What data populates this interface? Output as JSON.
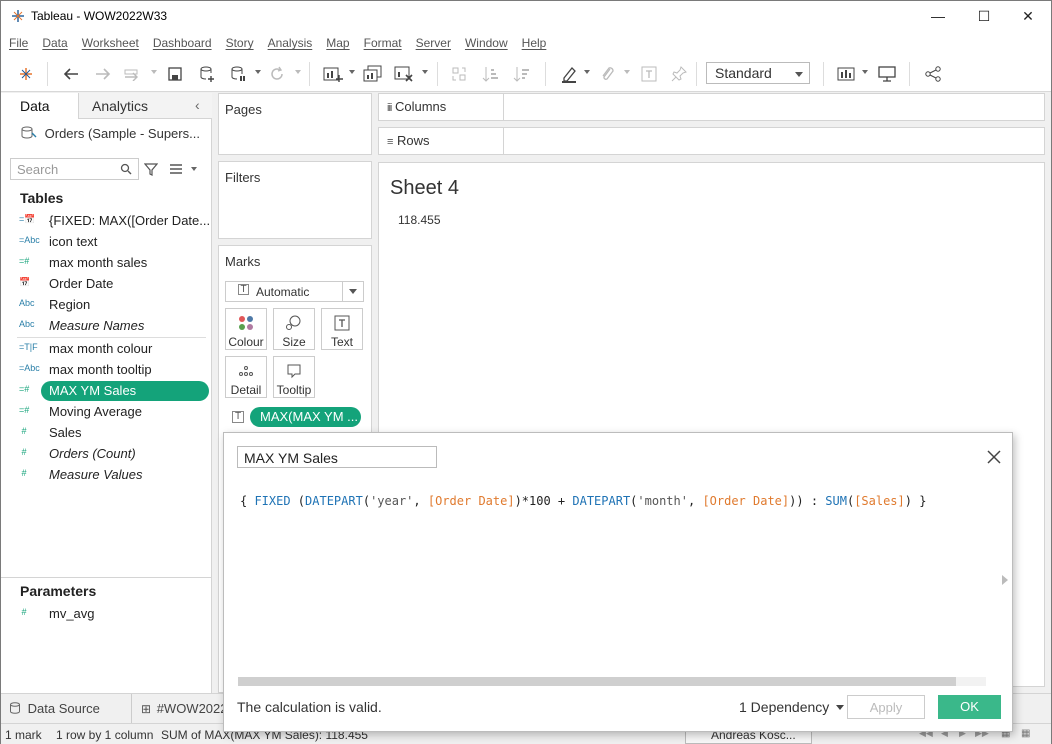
{
  "window": {
    "title": "Tableau - WOW2022W33"
  },
  "menu": [
    "File",
    "Data",
    "Worksheet",
    "Dashboard",
    "Story",
    "Analysis",
    "Map",
    "Format",
    "Server",
    "Window",
    "Help"
  ],
  "toolbar": {
    "fit_value": "Standard"
  },
  "left_pane": {
    "tab_data": "Data",
    "tab_analytics": "Analytics",
    "data_source": "Orders (Sample - Supers...",
    "search_placeholder": "Search",
    "tables_label": "Tables",
    "fields": [
      {
        "icon": "calendar-icon",
        "label": "{FIXED: MAX([Order Date..."
      },
      {
        "icon": "abc-icon",
        "label": "icon text"
      },
      {
        "icon": "hash-icon",
        "label": "max month sales"
      },
      {
        "icon": "calendar-icon",
        "label": "Order Date"
      },
      {
        "icon": "abc-icon",
        "label": "Region"
      },
      {
        "icon": "abc-icon",
        "label": "Measure Names"
      },
      {
        "icon": "tf-icon",
        "label": "max month colour"
      },
      {
        "icon": "abc-icon",
        "label": "max month tooltip"
      },
      {
        "icon": "hash-icon",
        "label": "MAX YM Sales"
      },
      {
        "icon": "hash-icon",
        "label": "Moving Average"
      },
      {
        "icon": "hash-icon",
        "label": "Sales"
      },
      {
        "icon": "hash-icon",
        "label": "Orders (Count)"
      },
      {
        "icon": "hash-icon",
        "label": "Measure Values"
      }
    ],
    "parameters_label": "Parameters",
    "parameters": [
      {
        "icon": "hash-icon",
        "label": "mv_avg"
      }
    ]
  },
  "cards": {
    "pages": "Pages",
    "filters": "Filters",
    "marks": "Marks",
    "mark_type": "Automatic",
    "mark_buttons": [
      "Colour",
      "Size",
      "Text",
      "Detail",
      "Tooltip"
    ],
    "mark_pill": "MAX(MAX YM ..."
  },
  "shelves": {
    "columns": "Columns",
    "rows": "Rows"
  },
  "view": {
    "sheet_title": "Sheet 4",
    "value": "118.455"
  },
  "calc_editor": {
    "name": "MAX YM Sales",
    "formula": {
      "p1": "{ ",
      "p2": "FIXED",
      "p3": " (",
      "p4": "DATEPART",
      "p5": "(",
      "p6": "'year'",
      "p7": ", ",
      "p8": "[Order Date]",
      "p9": ")*100 + ",
      "p10": "DATEPART",
      "p11": "(",
      "p12": "'month'",
      "p13": ", ",
      "p14": "[Order Date]",
      "p15": ")) : ",
      "p16": "SUM",
      "p17": "(",
      "p18": "[Sales]",
      "p19": ") }"
    },
    "status": "The calculation is valid.",
    "dependency": "1 Dependency",
    "apply_label": "Apply",
    "ok_label": "OK"
  },
  "bottom_tabs": {
    "data_source": "Data Source",
    "sheet": "#WOW2022"
  },
  "status_bar": {
    "marks": "1 mark",
    "dims": "1 row by 1 column",
    "sum": "SUM of MAX(MAX YM Sales): 118.455",
    "user": "Andreas Kosc..."
  }
}
